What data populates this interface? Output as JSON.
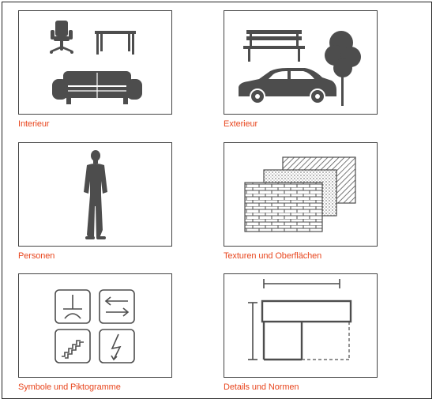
{
  "categories": [
    {
      "label": "Interieur",
      "icon": "furniture-icon"
    },
    {
      "label": "Exterieur",
      "icon": "car-tree-bench-icon"
    },
    {
      "label": "Personen",
      "icon": "person-silhouette-icon"
    },
    {
      "label": "Texturen und Oberflächen",
      "icon": "textures-icon"
    },
    {
      "label": "Symbole und Piktogramme",
      "icon": "pictograms-icon"
    },
    {
      "label": "Details und Normen",
      "icon": "dimension-drawing-icon"
    }
  ],
  "colors": {
    "link": "#e8461e",
    "icon": "#4d4d4d",
    "border": "#444444"
  }
}
